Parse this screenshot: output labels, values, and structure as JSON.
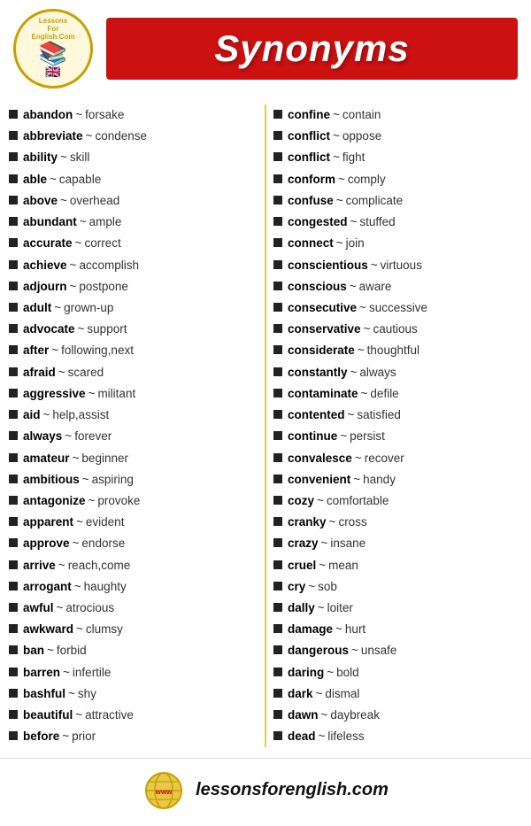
{
  "header": {
    "logo": {
      "top_text": "LessonsForEnglish.Com",
      "books_icon": "📚",
      "flag_icon": "🇬🇧"
    },
    "title": "Synonyms"
  },
  "footer": {
    "url": "lessonsforenglish.com"
  },
  "left_column": [
    {
      "word": "abandon",
      "synonym": "forsake"
    },
    {
      "word": "abbreviate",
      "synonym": "condense"
    },
    {
      "word": "ability",
      "synonym": "skill"
    },
    {
      "word": "able",
      "synonym": "capable"
    },
    {
      "word": "above",
      "synonym": "overhead"
    },
    {
      "word": "abundant",
      "synonym": "ample"
    },
    {
      "word": "accurate",
      "synonym": "correct"
    },
    {
      "word": "achieve",
      "synonym": "accomplish"
    },
    {
      "word": "adjourn",
      "synonym": "postpone"
    },
    {
      "word": "adult",
      "synonym": "grown-up"
    },
    {
      "word": "advocate",
      "synonym": "support"
    },
    {
      "word": "after",
      "synonym": "following,next"
    },
    {
      "word": "afraid",
      "synonym": "scared"
    },
    {
      "word": "aggressive",
      "synonym": "militant"
    },
    {
      "word": "aid",
      "synonym": "help,assist"
    },
    {
      "word": "always",
      "synonym": "forever"
    },
    {
      "word": "amateur",
      "synonym": "beginner"
    },
    {
      "word": "ambitious",
      "synonym": "aspiring"
    },
    {
      "word": "antagonize",
      "synonym": "provoke"
    },
    {
      "word": "apparent",
      "synonym": "evident"
    },
    {
      "word": "approve",
      "synonym": "endorse"
    },
    {
      "word": "arrive",
      "synonym": "reach,come"
    },
    {
      "word": "arrogant",
      "synonym": "haughty"
    },
    {
      "word": "awful",
      "synonym": "atrocious"
    },
    {
      "word": "awkward",
      "synonym": "clumsy"
    },
    {
      "word": "ban",
      "synonym": "forbid"
    },
    {
      "word": "barren",
      "synonym": "infertile"
    },
    {
      "word": "bashful",
      "synonym": "shy"
    },
    {
      "word": "beautiful",
      "synonym": "attractive"
    },
    {
      "word": "before",
      "synonym": "prior"
    }
  ],
  "right_column": [
    {
      "word": "confine",
      "synonym": "contain"
    },
    {
      "word": "conflict",
      "synonym": "oppose"
    },
    {
      "word": "conflict",
      "synonym": "fight"
    },
    {
      "word": "conform",
      "synonym": "comply"
    },
    {
      "word": "confuse",
      "synonym": "complicate"
    },
    {
      "word": "congested",
      "synonym": "stuffed"
    },
    {
      "word": "connect",
      "synonym": "join"
    },
    {
      "word": "conscientious",
      "synonym": "virtuous"
    },
    {
      "word": "conscious",
      "synonym": "aware"
    },
    {
      "word": "consecutive",
      "synonym": "successive"
    },
    {
      "word": "conservative",
      "synonym": "cautious"
    },
    {
      "word": "considerate",
      "synonym": "thoughtful"
    },
    {
      "word": "constantly",
      "synonym": "always"
    },
    {
      "word": "contaminate",
      "synonym": "defile"
    },
    {
      "word": "contented",
      "synonym": "satisfied"
    },
    {
      "word": "continue",
      "synonym": "persist"
    },
    {
      "word": "convalesce",
      "synonym": "recover"
    },
    {
      "word": "convenient",
      "synonym": "handy"
    },
    {
      "word": "cozy",
      "synonym": "comfortable"
    },
    {
      "word": "cranky",
      "synonym": "cross"
    },
    {
      "word": "crazy",
      "synonym": "insane"
    },
    {
      "word": "cruel",
      "synonym": "mean"
    },
    {
      "word": "cry",
      "synonym": "sob"
    },
    {
      "word": "dally",
      "synonym": "loiter"
    },
    {
      "word": "damage",
      "synonym": "hurt"
    },
    {
      "word": "dangerous",
      "synonym": "unsafe"
    },
    {
      "word": "daring",
      "synonym": "bold"
    },
    {
      "word": "dark",
      "synonym": "dismal"
    },
    {
      "word": "dawn",
      "synonym": "daybreak"
    },
    {
      "word": "dead",
      "synonym": "lifeless"
    }
  ]
}
